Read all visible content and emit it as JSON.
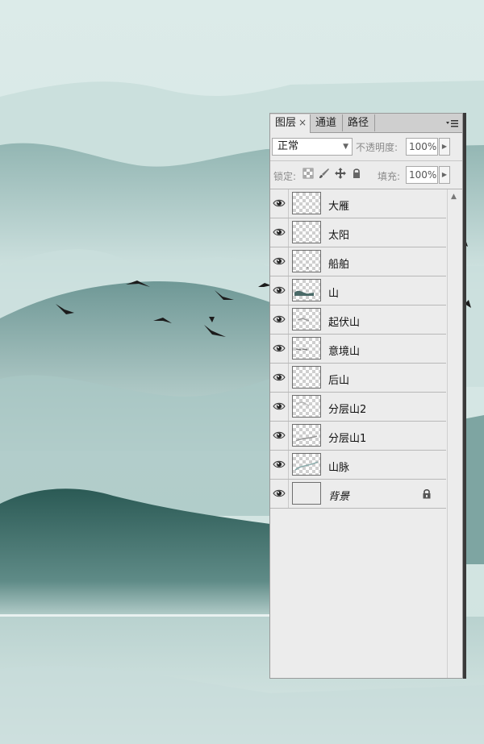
{
  "panel": {
    "tabs": [
      {
        "label": "图层",
        "close": "×",
        "active": true
      },
      {
        "label": "通道",
        "active": false
      },
      {
        "label": "路径",
        "active": false
      }
    ],
    "blend_mode": "正常",
    "opacity_label": "不透明度:",
    "opacity_value": "100%",
    "lock_label": "锁定:",
    "fill_label": "填充:",
    "fill_value": "100%"
  },
  "layers": [
    {
      "name": "大雁",
      "visible": true,
      "locked": false
    },
    {
      "name": "太阳",
      "visible": true,
      "locked": false
    },
    {
      "name": "船舶",
      "visible": true,
      "locked": false
    },
    {
      "name": "山",
      "visible": true,
      "locked": false
    },
    {
      "name": "起伏山",
      "visible": true,
      "locked": false
    },
    {
      "name": "意境山",
      "visible": true,
      "locked": false
    },
    {
      "name": "后山",
      "visible": true,
      "locked": false
    },
    {
      "name": "分层山2",
      "visible": true,
      "locked": false
    },
    {
      "name": "分层山1",
      "visible": true,
      "locked": false
    },
    {
      "name": "山脉",
      "visible": true,
      "locked": false
    },
    {
      "name": "背景",
      "visible": true,
      "locked": true
    }
  ],
  "colors": {
    "sky": "#dcebe9",
    "mist": "#c9dfdc",
    "mid_mountain": "#6f9896",
    "far_mountain": "#93b6b3",
    "dark_mountain": "#2f5e59",
    "water": "#a7c4c1",
    "panel_bg": "#ececec",
    "bird": "#1c1c1c"
  }
}
